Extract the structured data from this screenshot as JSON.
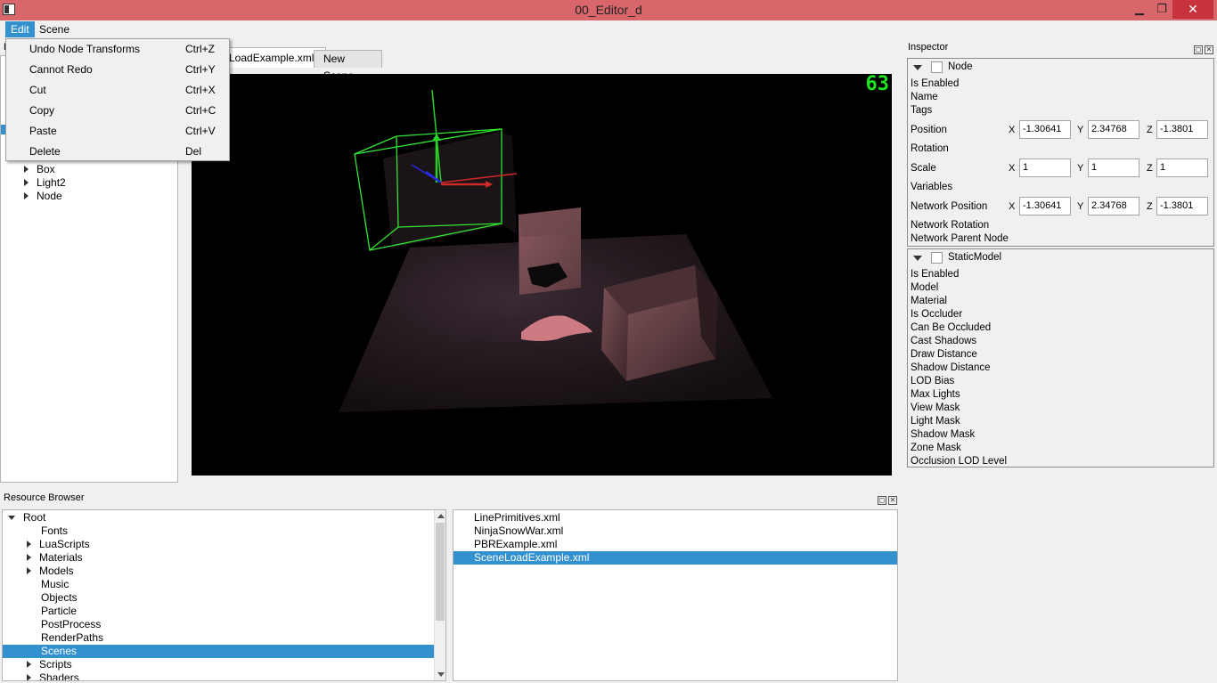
{
  "window": {
    "title": "00_Editor_d",
    "minimize": "▁",
    "maximize": "❐",
    "close": "✕"
  },
  "menubar": {
    "edit": "Edit",
    "scene": "Scene"
  },
  "edit_menu": [
    {
      "label": "Undo Node Transforms",
      "shortcut": "Ctrl+Z"
    },
    {
      "label": "Cannot Redo",
      "shortcut": "Ctrl+Y"
    },
    {
      "label": "Cut",
      "shortcut": "Ctrl+X"
    },
    {
      "label": "Copy",
      "shortcut": "Ctrl+C"
    },
    {
      "label": "Paste",
      "shortcut": "Ctrl+V"
    },
    {
      "label": "Delete",
      "shortcut": "Del"
    }
  ],
  "hierarchy": {
    "title": "H",
    "items": [
      "Box",
      "Light2",
      "Node"
    ]
  },
  "viewport": {
    "tabs": [
      "LoadExample.xml",
      "New Scene"
    ],
    "fps": "63"
  },
  "resource_browser": {
    "title": "Resource Browser",
    "tree": [
      "Root",
      "Fonts",
      "LuaScripts",
      "Materials",
      "Models",
      "Music",
      "Objects",
      "Particle",
      "PostProcess",
      "RenderPaths",
      "Scenes",
      "Scripts",
      "Shaders"
    ],
    "selected_folder": "Scenes",
    "files": [
      "LinePrimitives.xml",
      "NinjaSnowWar.xml",
      "PBRExample.xml",
      "SceneLoadExample.xml"
    ],
    "selected_file": "SceneLoadExample.xml"
  },
  "inspector": {
    "title": "Inspector",
    "node": {
      "header": "Node",
      "is_enabled": "Is Enabled",
      "name": "Name",
      "tags": "Tags",
      "position": {
        "label": "Position",
        "x": "-1.30641",
        "y": "2.34768",
        "z": "-1.3801"
      },
      "rotation": "Rotation",
      "scale": {
        "label": "Scale",
        "x": "1",
        "y": "1",
        "z": "1"
      },
      "variables": "Variables",
      "network_position": {
        "label": "Network Position",
        "x": "-1.30641",
        "y": "2.34768",
        "z": "-1.3801"
      },
      "network_rotation": "Network Rotation",
      "network_parent_node": "Network Parent Node",
      "axis_x": "X",
      "axis_y": "Y",
      "axis_z": "Z"
    },
    "static_model": {
      "header": "StaticModel",
      "attributes": [
        "Is Enabled",
        "Model",
        "Material",
        "Is Occluder",
        "Can Be Occluded",
        "Cast Shadows",
        "Draw Distance",
        "Shadow Distance",
        "LOD Bias",
        "Max Lights",
        "View Mask",
        "Light Mask",
        "Shadow Mask",
        "Zone Mask",
        "Occlusion LOD Level"
      ]
    }
  },
  "colors": {
    "titlebar": "#d9666b",
    "selection": "#3391cf",
    "fps": "#1ee51e",
    "gizmo_box": "#32e632"
  }
}
